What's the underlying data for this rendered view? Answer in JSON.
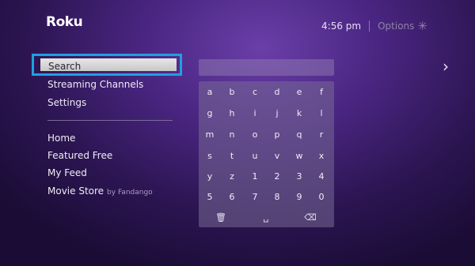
{
  "brand": {
    "logo": "Roku"
  },
  "header": {
    "time": "4:56  pm",
    "options_label": "Options",
    "options_icon": "asterisk-icon"
  },
  "menu": {
    "selected": "Search",
    "items_top": [
      "Streaming Channels",
      "Settings"
    ],
    "items_bottom": [
      {
        "label": "Home"
      },
      {
        "label": "Featured Free"
      },
      {
        "label": "My Feed"
      },
      {
        "label": "Movie Store",
        "sub": "by Fandango"
      }
    ]
  },
  "search": {
    "query": ""
  },
  "keyboard": {
    "rows": [
      [
        "a",
        "b",
        "c",
        "d",
        "e",
        "f"
      ],
      [
        "g",
        "h",
        "i",
        "j",
        "k",
        "l"
      ],
      [
        "m",
        "n",
        "o",
        "p",
        "q",
        "r"
      ],
      [
        "s",
        "t",
        "u",
        "v",
        "w",
        "x"
      ],
      [
        "y",
        "z",
        "1",
        "2",
        "3",
        "4"
      ],
      [
        "5",
        "6",
        "7",
        "8",
        "9",
        "0"
      ]
    ],
    "controls": [
      {
        "name": "clear-key",
        "icon": "trash-icon",
        "glyph": "🗑"
      },
      {
        "name": "space-key",
        "icon": "space-icon",
        "glyph": "␣"
      },
      {
        "name": "backspace-key",
        "icon": "backspace-icon",
        "glyph": "⌫"
      }
    ]
  },
  "nav": {
    "next_icon": "chevron-right-icon"
  },
  "colors": {
    "selection_border": "#1fa0e0",
    "background": "#4a2682"
  }
}
